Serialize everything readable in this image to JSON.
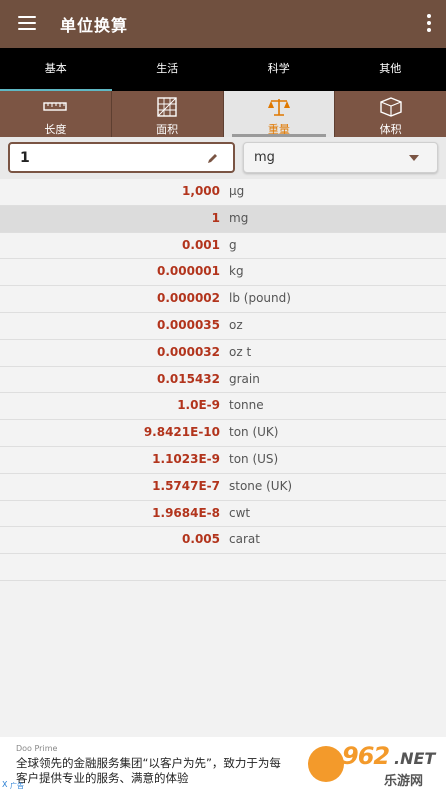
{
  "app": {
    "title": "单位换算"
  },
  "tabs": [
    {
      "label": "基本",
      "active": true
    },
    {
      "label": "生活"
    },
    {
      "label": "科学"
    },
    {
      "label": "其他"
    }
  ],
  "categories": [
    {
      "label": "长度",
      "icon": "ruler-icon"
    },
    {
      "label": "面积",
      "icon": "area-grid-icon"
    },
    {
      "label": "重量",
      "icon": "scale-icon",
      "active": true
    },
    {
      "label": "体积",
      "icon": "cube-icon"
    }
  ],
  "input": {
    "value": "1",
    "unit": "mg"
  },
  "results": [
    {
      "value": "1,000",
      "unit": "µg"
    },
    {
      "value": "1",
      "unit": "mg",
      "selected": true
    },
    {
      "value": "0.001",
      "unit": "g"
    },
    {
      "value": "0.000001",
      "unit": "kg"
    },
    {
      "value": "0.000002",
      "unit": "lb (pound)"
    },
    {
      "value": "0.000035",
      "unit": "oz"
    },
    {
      "value": "0.000032",
      "unit": "oz t"
    },
    {
      "value": "0.015432",
      "unit": "grain"
    },
    {
      "value": "1.0E-9",
      "unit": "tonne"
    },
    {
      "value": "9.8421E-10",
      "unit": "ton (UK)"
    },
    {
      "value": "1.1023E-9",
      "unit": "ton (US)"
    },
    {
      "value": "1.5747E-7",
      "unit": "stone (UK)"
    },
    {
      "value": "1.9684E-8",
      "unit": "cwt"
    },
    {
      "value": "0.005",
      "unit": "carat"
    },
    {
      "value": "",
      "unit": ""
    }
  ],
  "ad": {
    "brand": "Doo Prime",
    "line1": "全球领先的金融服务集团“以客户为先”，致力于为每",
    "line2": "客户提供专业的服务、满意的体验",
    "close": "X",
    "tag": "广告"
  },
  "watermark": {
    "number": "962",
    "suffix": ".NET",
    "text": "乐游网"
  },
  "colors": {
    "appbar": "#70503f",
    "accent": "#e07800",
    "value": "#b2341c",
    "tab_indicator": "#5fb8c4"
  }
}
